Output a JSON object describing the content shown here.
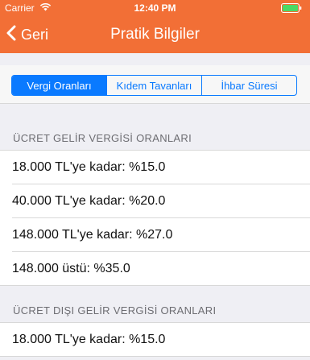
{
  "status_bar": {
    "carrier": "Carrier",
    "time": "12:40 PM"
  },
  "nav": {
    "back_label": "Geri",
    "title": "Pratik Bilgiler"
  },
  "segments": [
    {
      "label": "Vergi Oranları",
      "active": true
    },
    {
      "label": "Kıdem Tavanları",
      "active": false
    },
    {
      "label": "İhbar Süresi",
      "active": false
    }
  ],
  "sections": [
    {
      "header": "ÜCRET GELİR VERGİSİ ORANLARI",
      "rows": [
        "18.000 TL'ye kadar: %15.0",
        "40.000 TL'ye kadar: %20.0",
        "148.000 TL'ye kadar: %27.0",
        "148.000 üstü: %35.0"
      ]
    },
    {
      "header": "ÜCRET DIŞI GELİR VERGİSİ ORANLARI",
      "rows": [
        "18.000 TL'ye kadar: %15.0"
      ]
    }
  ],
  "colors": {
    "nav_background": "#f26f36",
    "accent": "#0a7aff",
    "battery": "#4cd964"
  }
}
